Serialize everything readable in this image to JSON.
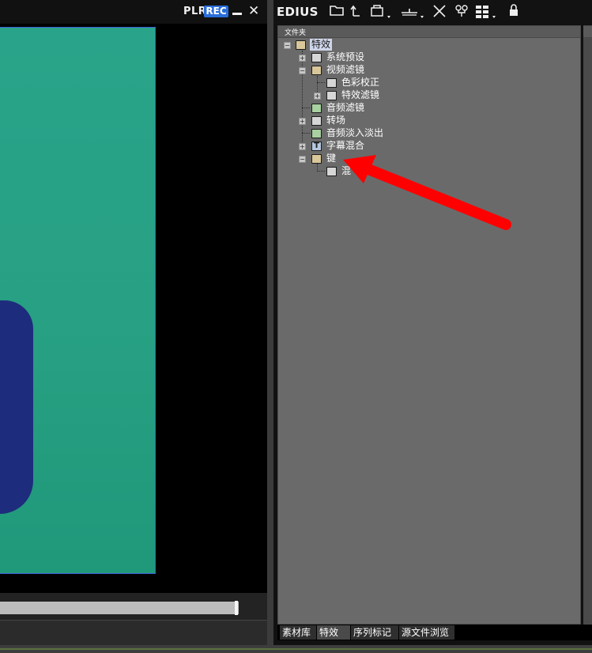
{
  "player": {
    "plr_label": "PLR",
    "rec_label": "REC",
    "minimize_icon": "minimize-icon",
    "close_icon": "close-icon",
    "scrubber_progress": 0.99
  },
  "bin": {
    "app_name": "EDIUS",
    "toolbar_icons": [
      "folder-icon",
      "up-folder-icon",
      "clip-import-icon",
      "add-clip-icon",
      "cut-icon",
      "effects-icon",
      "view-mode-icon",
      "lock-icon"
    ],
    "panel_title": "文件夹",
    "tree": {
      "root": "特效",
      "system_presets": "系统预设",
      "video_filters": "视频滤镜",
      "color_correction": "色彩校正",
      "special_filters": "特效滤镜",
      "audio_filters": "音频滤镜",
      "transitions": "转场",
      "audio_fade": "音频淡入淡出",
      "title_mix": "字幕混合",
      "keys": "键",
      "mix_partial": "混"
    },
    "tabs": [
      "素材库",
      "特效",
      "序列标记",
      "源文件浏览"
    ],
    "active_tab_index": 1
  },
  "colors": {
    "rec_badge": "#2a6ed8",
    "green_screen": "#27a083",
    "annotation_arrow": "#ff0000"
  }
}
